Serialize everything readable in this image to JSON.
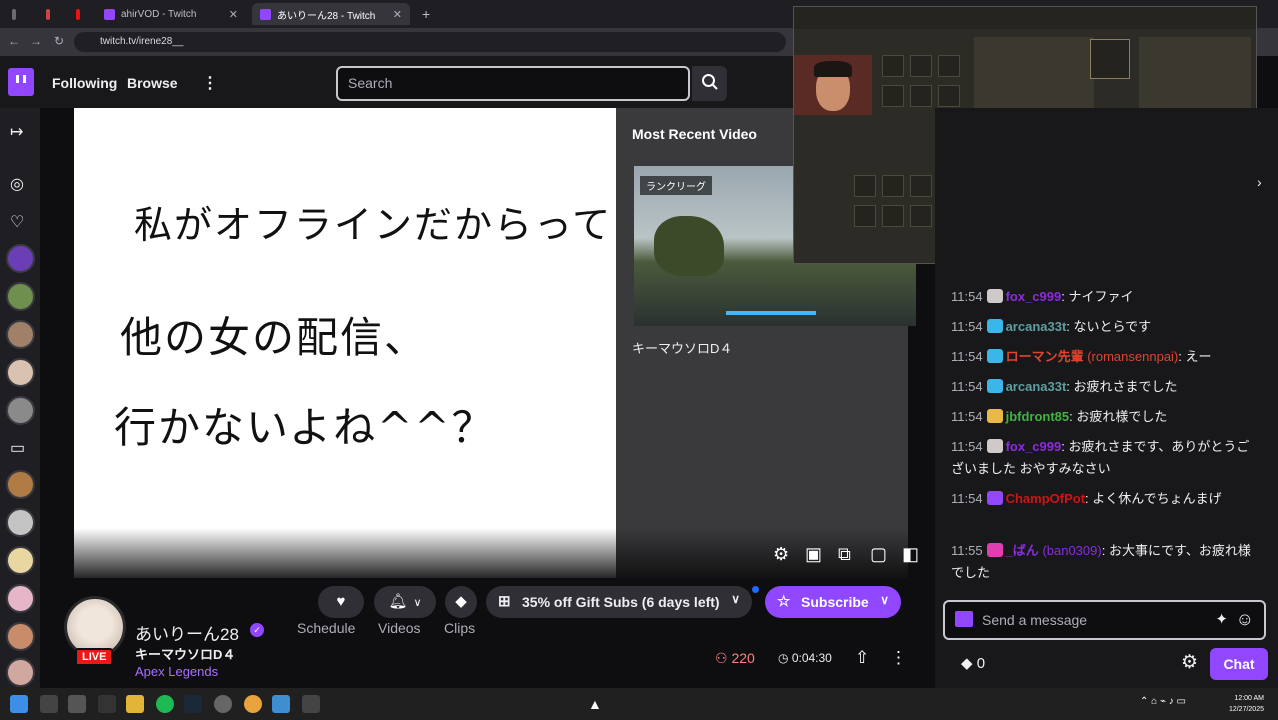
{
  "browser": {
    "tabs": [
      {
        "label": "ahirVOD - Twitch"
      },
      {
        "label": "あいりーん28 - Twitch"
      }
    ],
    "url": "twitch.tv/irene28__"
  },
  "topnav": {
    "following": "Following",
    "browse": "Browse",
    "search_placeholder": "Search"
  },
  "whiteboard": {
    "line1": "私がオフラインだからって",
    "line2": "他の女の配信、",
    "line3": "行かないよね^^？"
  },
  "offline": {
    "heading": "Most Recent Video",
    "thumb_badge": "ランクリーグ",
    "caption": "キーマウソロD４"
  },
  "channel": {
    "name": "あいりーん28",
    "title": "キーマウソロD４",
    "game": "Apex Legends",
    "live": "LIVE",
    "viewers": "220",
    "uptime": "0:04:30"
  },
  "actions": {
    "schedule": "Schedule",
    "videos": "Videos",
    "clips": "Clips",
    "gift": "35% off Gift Subs (6 days left)",
    "subscribe": "Subscribe"
  },
  "chat": {
    "messages": [
      {
        "time": "11:54",
        "user": "fox_c999",
        "text": ": ナイファイ",
        "color": "#8a2be2"
      },
      {
        "time": "11:54",
        "user": "arcana33t",
        "text": ": ないとらです",
        "color": "#5f9ea0"
      },
      {
        "time": "11:54",
        "user": "ローマン先輩",
        "display": "(romansennpai)",
        "text": ": えー",
        "color": "#e0442e"
      },
      {
        "time": "11:54",
        "user": "arcana33t",
        "text": ": お疲れさまでした",
        "color": "#5f9ea0"
      },
      {
        "time": "11:54",
        "user": "jbfdront85",
        "text": ": お疲れ様でした",
        "color": "#41b341"
      },
      {
        "time": "11:54",
        "user": "fox_c999",
        "text": ": お疲れさまです、ありがとうございました おやすみなさい",
        "color": "#8a2be2"
      },
      {
        "time": "11:54",
        "user": "ChampOfPot",
        "text": ": よく休んでちょんまげ",
        "color": "#d01414"
      },
      {
        "time": "11:55",
        "user": "_ばん",
        "display": "(ban0309)",
        "text": ": お大事にです、お疲れ様でした",
        "color": "#8a2be2"
      }
    ],
    "input_placeholder": "Send a message",
    "points": "0",
    "chat_button": "Chat"
  },
  "taskbar": {
    "time": "12:00 AM",
    "date": "12/27/2025"
  },
  "icons": [
    "search-icon",
    "heart-icon",
    "bell-icon",
    "clips-icon",
    "gift-icon",
    "star-icon",
    "gear-icon",
    "share-icon",
    "more-icon"
  ]
}
